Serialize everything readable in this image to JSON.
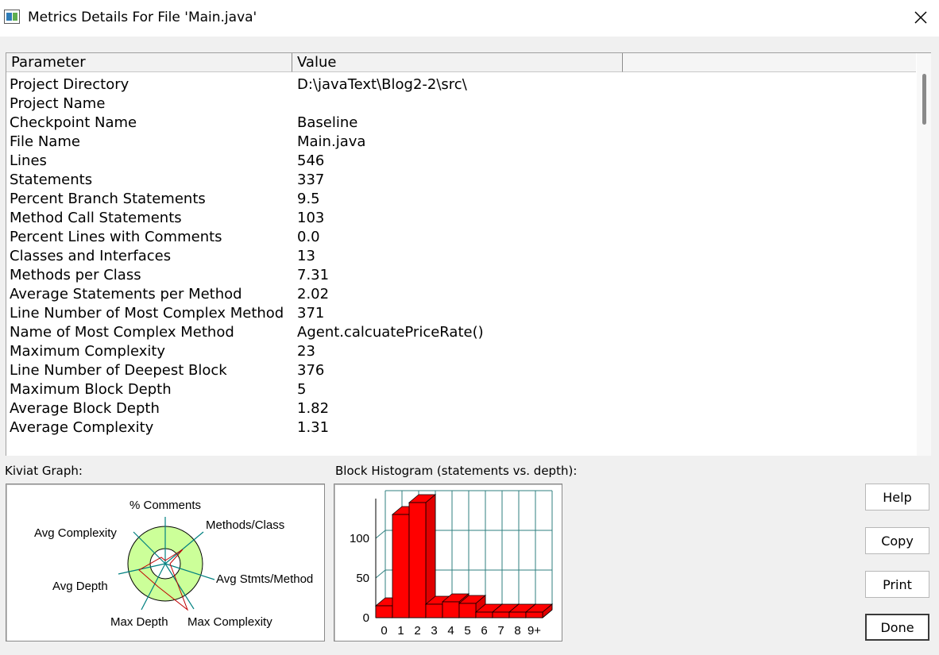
{
  "window": {
    "title": "Metrics Details For File 'Main.java'"
  },
  "table": {
    "headers": [
      "Parameter",
      "Value",
      ""
    ],
    "rows": [
      {
        "param": "Project Directory",
        "value": "D:\\javaText\\Blog2-2\\src\\"
      },
      {
        "param": "Project Name",
        "value": ""
      },
      {
        "param": "Checkpoint Name",
        "value": "Baseline"
      },
      {
        "param": "File Name",
        "value": "Main.java"
      },
      {
        "param": "Lines",
        "value": "546"
      },
      {
        "param": "Statements",
        "value": "337"
      },
      {
        "param": "Percent Branch Statements",
        "value": "9.5"
      },
      {
        "param": "Method Call Statements",
        "value": "103"
      },
      {
        "param": "Percent Lines with Comments",
        "value": "0.0"
      },
      {
        "param": "Classes and Interfaces",
        "value": "13"
      },
      {
        "param": "Methods per Class",
        "value": "7.31"
      },
      {
        "param": "Average Statements per Method",
        "value": "2.02"
      },
      {
        "param": "Line Number of Most Complex Method",
        "value": "371"
      },
      {
        "param": "Name of Most Complex Method",
        "value": "Agent.calcuatePriceRate()"
      },
      {
        "param": "Maximum Complexity",
        "value": "23"
      },
      {
        "param": "Line Number of Deepest Block",
        "value": "376"
      },
      {
        "param": "Maximum Block Depth",
        "value": "5"
      },
      {
        "param": "Average Block Depth",
        "value": "1.82"
      },
      {
        "param": "Average Complexity",
        "value": "1.31"
      }
    ]
  },
  "kiviat": {
    "label": "Kiviat Graph:",
    "axes": [
      "% Comments",
      "Methods/Class",
      "Avg Stmts/Method",
      "Max Complexity",
      "Max Depth",
      "Avg Depth",
      "Avg Complexity"
    ],
    "ring_color": "#ccff99",
    "line_color": "#c00000"
  },
  "histogram": {
    "label": "Block Histogram (statements vs. depth):"
  },
  "chart_data": {
    "type": "bar",
    "categories": [
      "0",
      "1",
      "2",
      "3",
      "4",
      "5",
      "6",
      "7",
      "8",
      "9+"
    ],
    "values": [
      15,
      130,
      145,
      17,
      20,
      18,
      7,
      7,
      7,
      7
    ],
    "title": "",
    "xlabel": "",
    "ylabel": "",
    "ylim": [
      0,
      150
    ],
    "yticks": [
      "0",
      "50",
      "100"
    ],
    "grid": true,
    "bar_color": "#ff0000",
    "grid_color": "#2f7f7f"
  },
  "buttons": {
    "help": "Help",
    "copy": "Copy",
    "print": "Print",
    "done": "Done"
  }
}
